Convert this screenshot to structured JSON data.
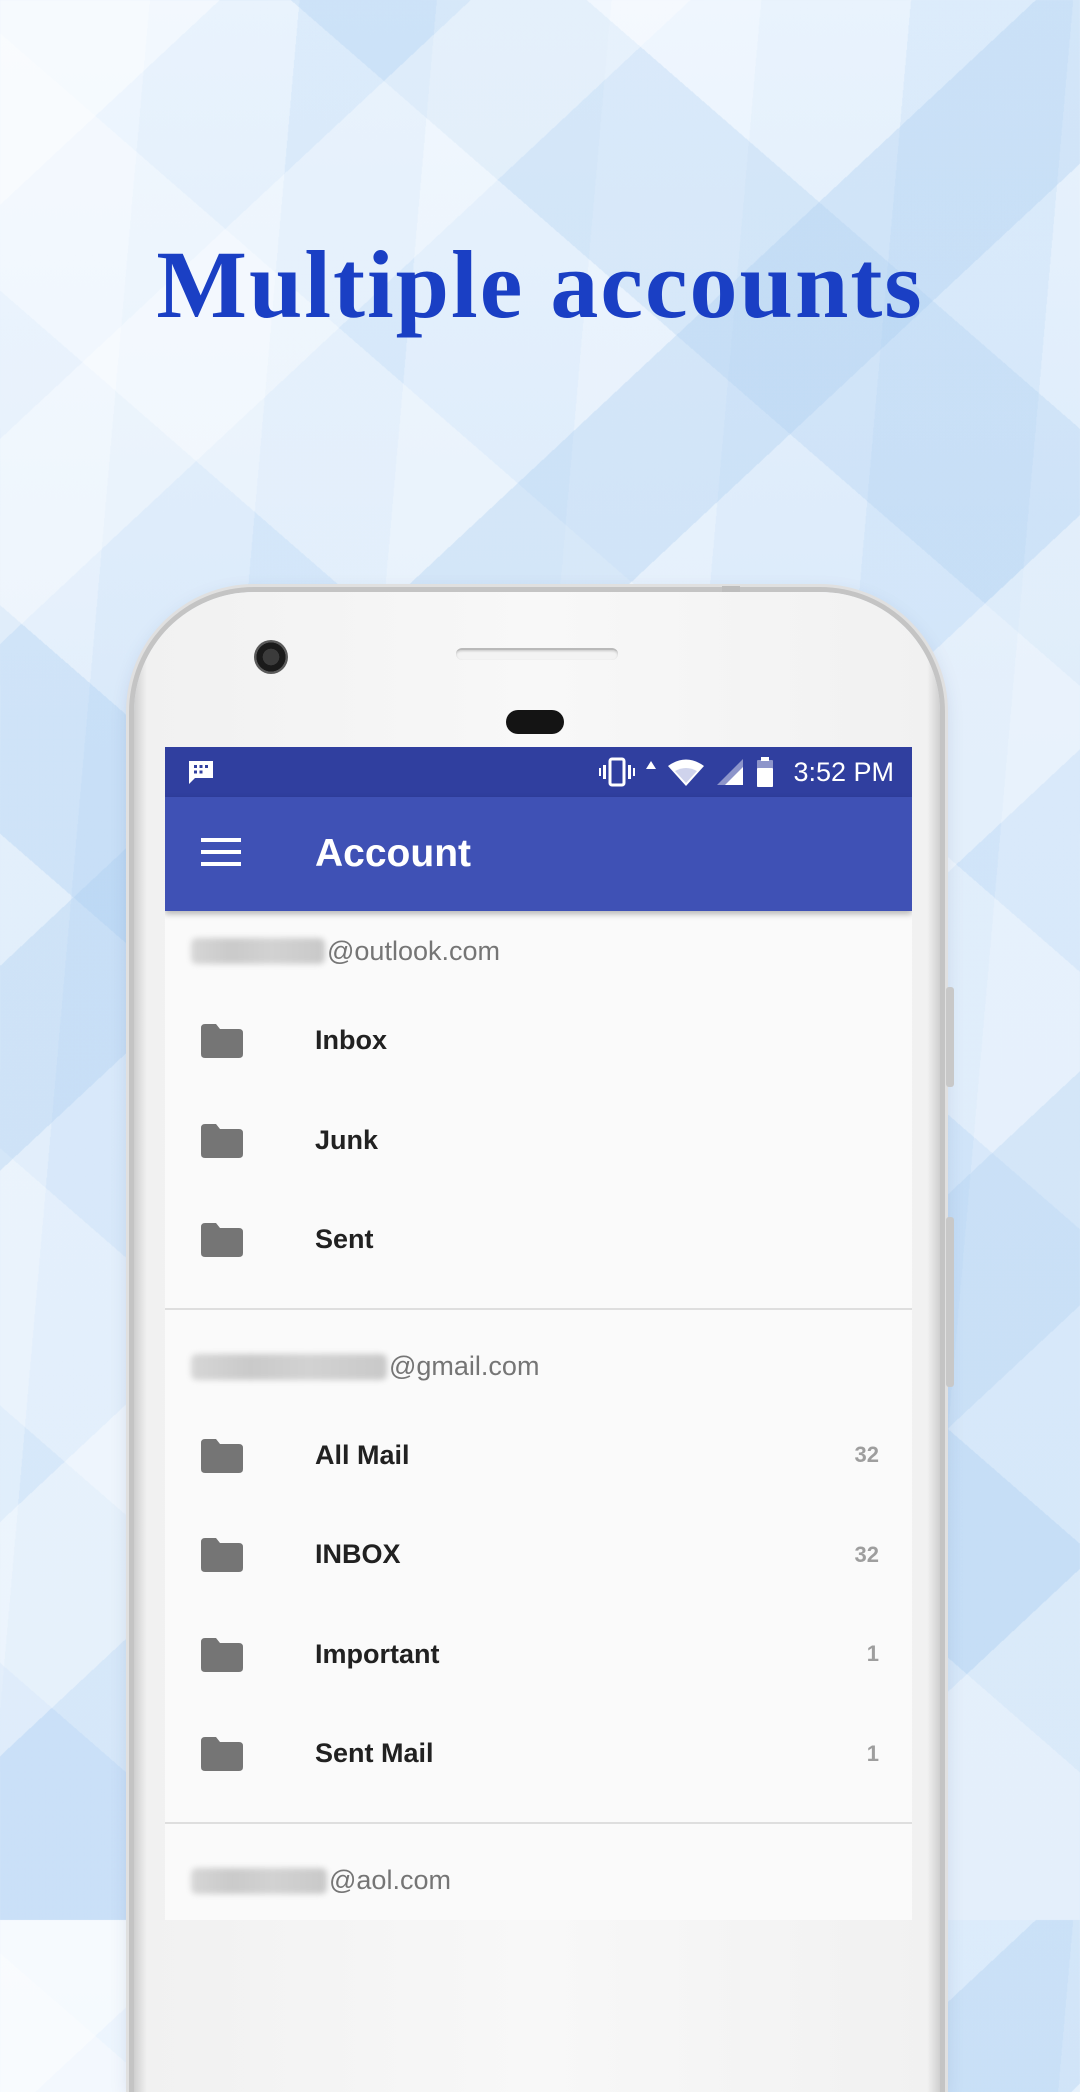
{
  "headline": "Multiple accounts",
  "status_bar": {
    "time": "3:52 PM",
    "icons": [
      "bbm-chat-icon",
      "vibrate-icon",
      "data-up-icon",
      "wifi-icon",
      "cell-signal-icon",
      "battery-icon"
    ]
  },
  "app_bar": {
    "title": "Account",
    "menu_icon": "hamburger-menu-icon"
  },
  "accounts": [
    {
      "email_suffix": "@outlook.com",
      "folders": [
        {
          "label": "Inbox",
          "count": ""
        },
        {
          "label": "Junk",
          "count": ""
        },
        {
          "label": "Sent",
          "count": ""
        }
      ]
    },
    {
      "email_suffix": "@gmail.com",
      "folders": [
        {
          "label": "All Mail",
          "count": "32"
        },
        {
          "label": "INBOX",
          "count": "32"
        },
        {
          "label": "Important",
          "count": "1"
        },
        {
          "label": "Sent Mail",
          "count": "1"
        }
      ]
    },
    {
      "email_suffix": "@aol.com",
      "folders": []
    }
  ],
  "colors": {
    "headline": "#1a3fc4",
    "status_bar": "#303f9f",
    "app_bar": "#3f51b5",
    "folder_icon": "#757575",
    "screen_bg": "#fafafa"
  }
}
